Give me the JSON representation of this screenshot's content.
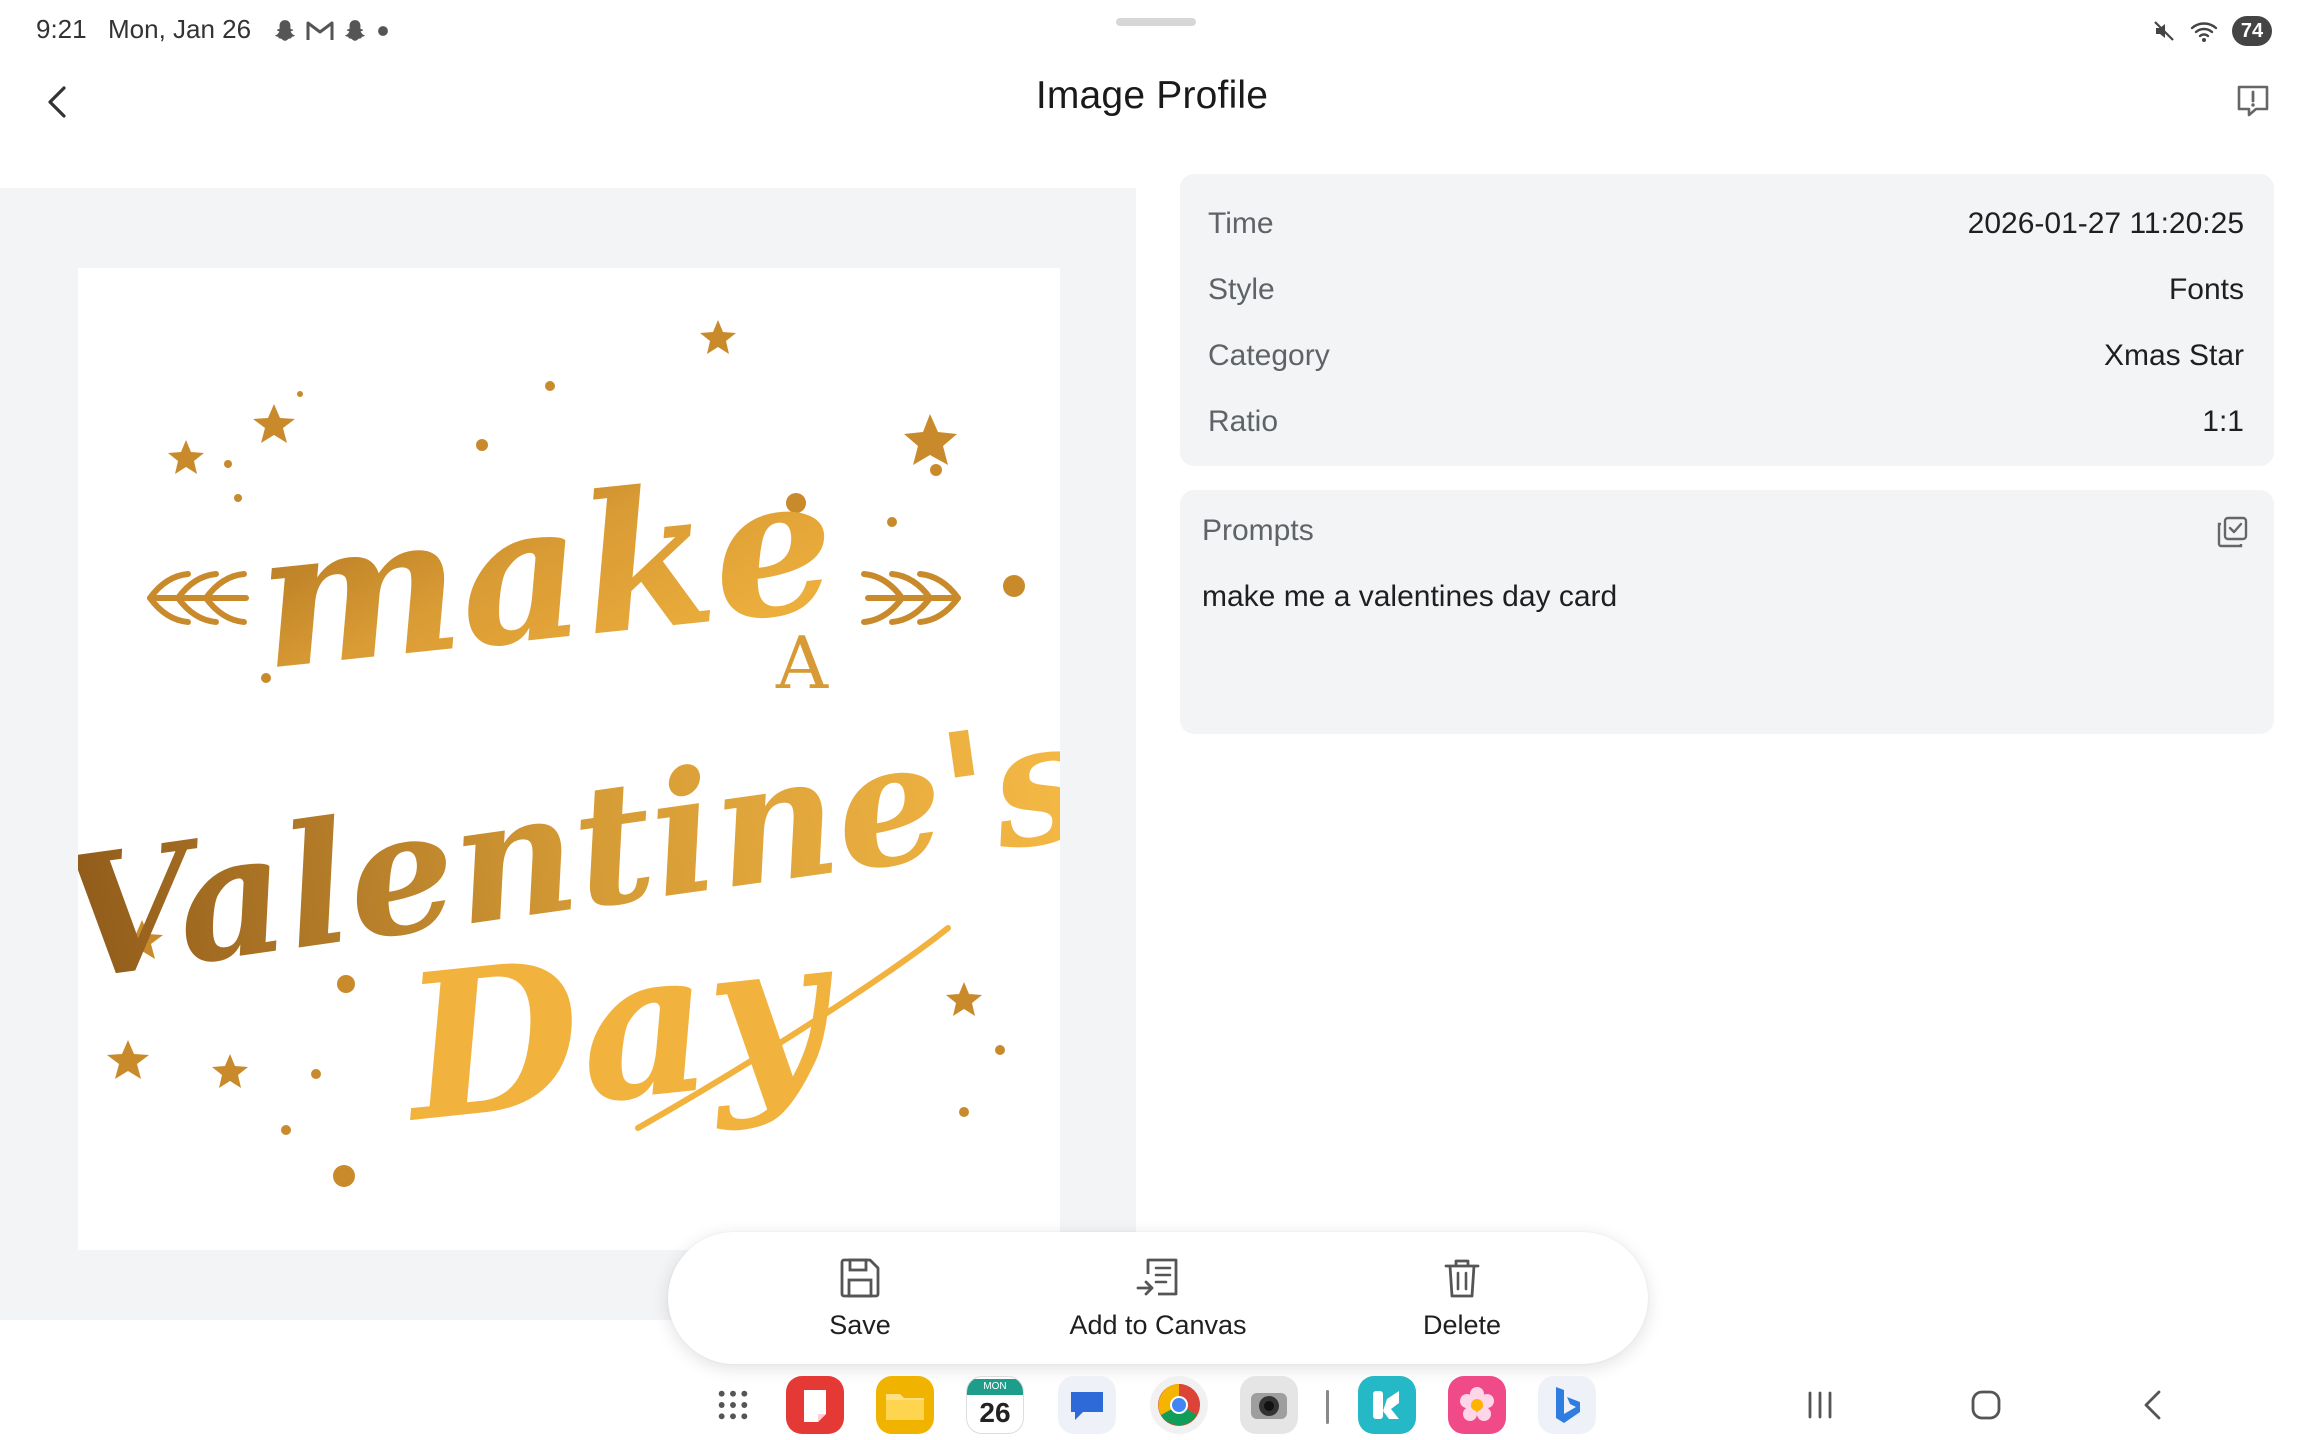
{
  "status_bar": {
    "time": "9:21",
    "date": "Mon, Jan 26",
    "notification_icons": [
      "snapchat-icon",
      "gmail-icon",
      "snapchat-icon",
      "more-dot-icon"
    ],
    "system_icons": [
      "mute-icon",
      "wifi-icon"
    ],
    "battery": "74"
  },
  "app_bar": {
    "title": "Image Profile",
    "back_icon": "back-arrow-icon",
    "report_icon": "feedback-icon"
  },
  "image": {
    "alt_lettering": [
      "make",
      "A",
      "Valentine's",
      "Day"
    ],
    "gold_color": "#e8a93a",
    "dark_gold_color": "#a86f1f"
  },
  "details": {
    "rows": [
      {
        "label": "Time",
        "value": "2026-01-27 11:20:25"
      },
      {
        "label": "Style",
        "value": "Fonts"
      },
      {
        "label": "Category",
        "value": "Xmas Star"
      },
      {
        "label": "Ratio",
        "value": "1:1"
      }
    ]
  },
  "prompts": {
    "title": "Prompts",
    "text": "make me a valentines day card",
    "copy_icon": "copy-icon"
  },
  "actions": {
    "save_label": "Save",
    "add_to_canvas_label": "Add to Canvas",
    "delete_label": "Delete"
  },
  "taskbar": {
    "apps": [
      "app-drawer",
      "notes",
      "files",
      "calendar",
      "messages",
      "chrome",
      "camera",
      "app-store",
      "gallery",
      "bing"
    ],
    "calendar_day": "26",
    "calendar_weekday": "MON"
  },
  "colors": {
    "panel_bg": "#f3f4f6",
    "card_bg": "#f3f4f6",
    "label_text": "#5f6368",
    "primary_text": "#1f1f1f"
  }
}
